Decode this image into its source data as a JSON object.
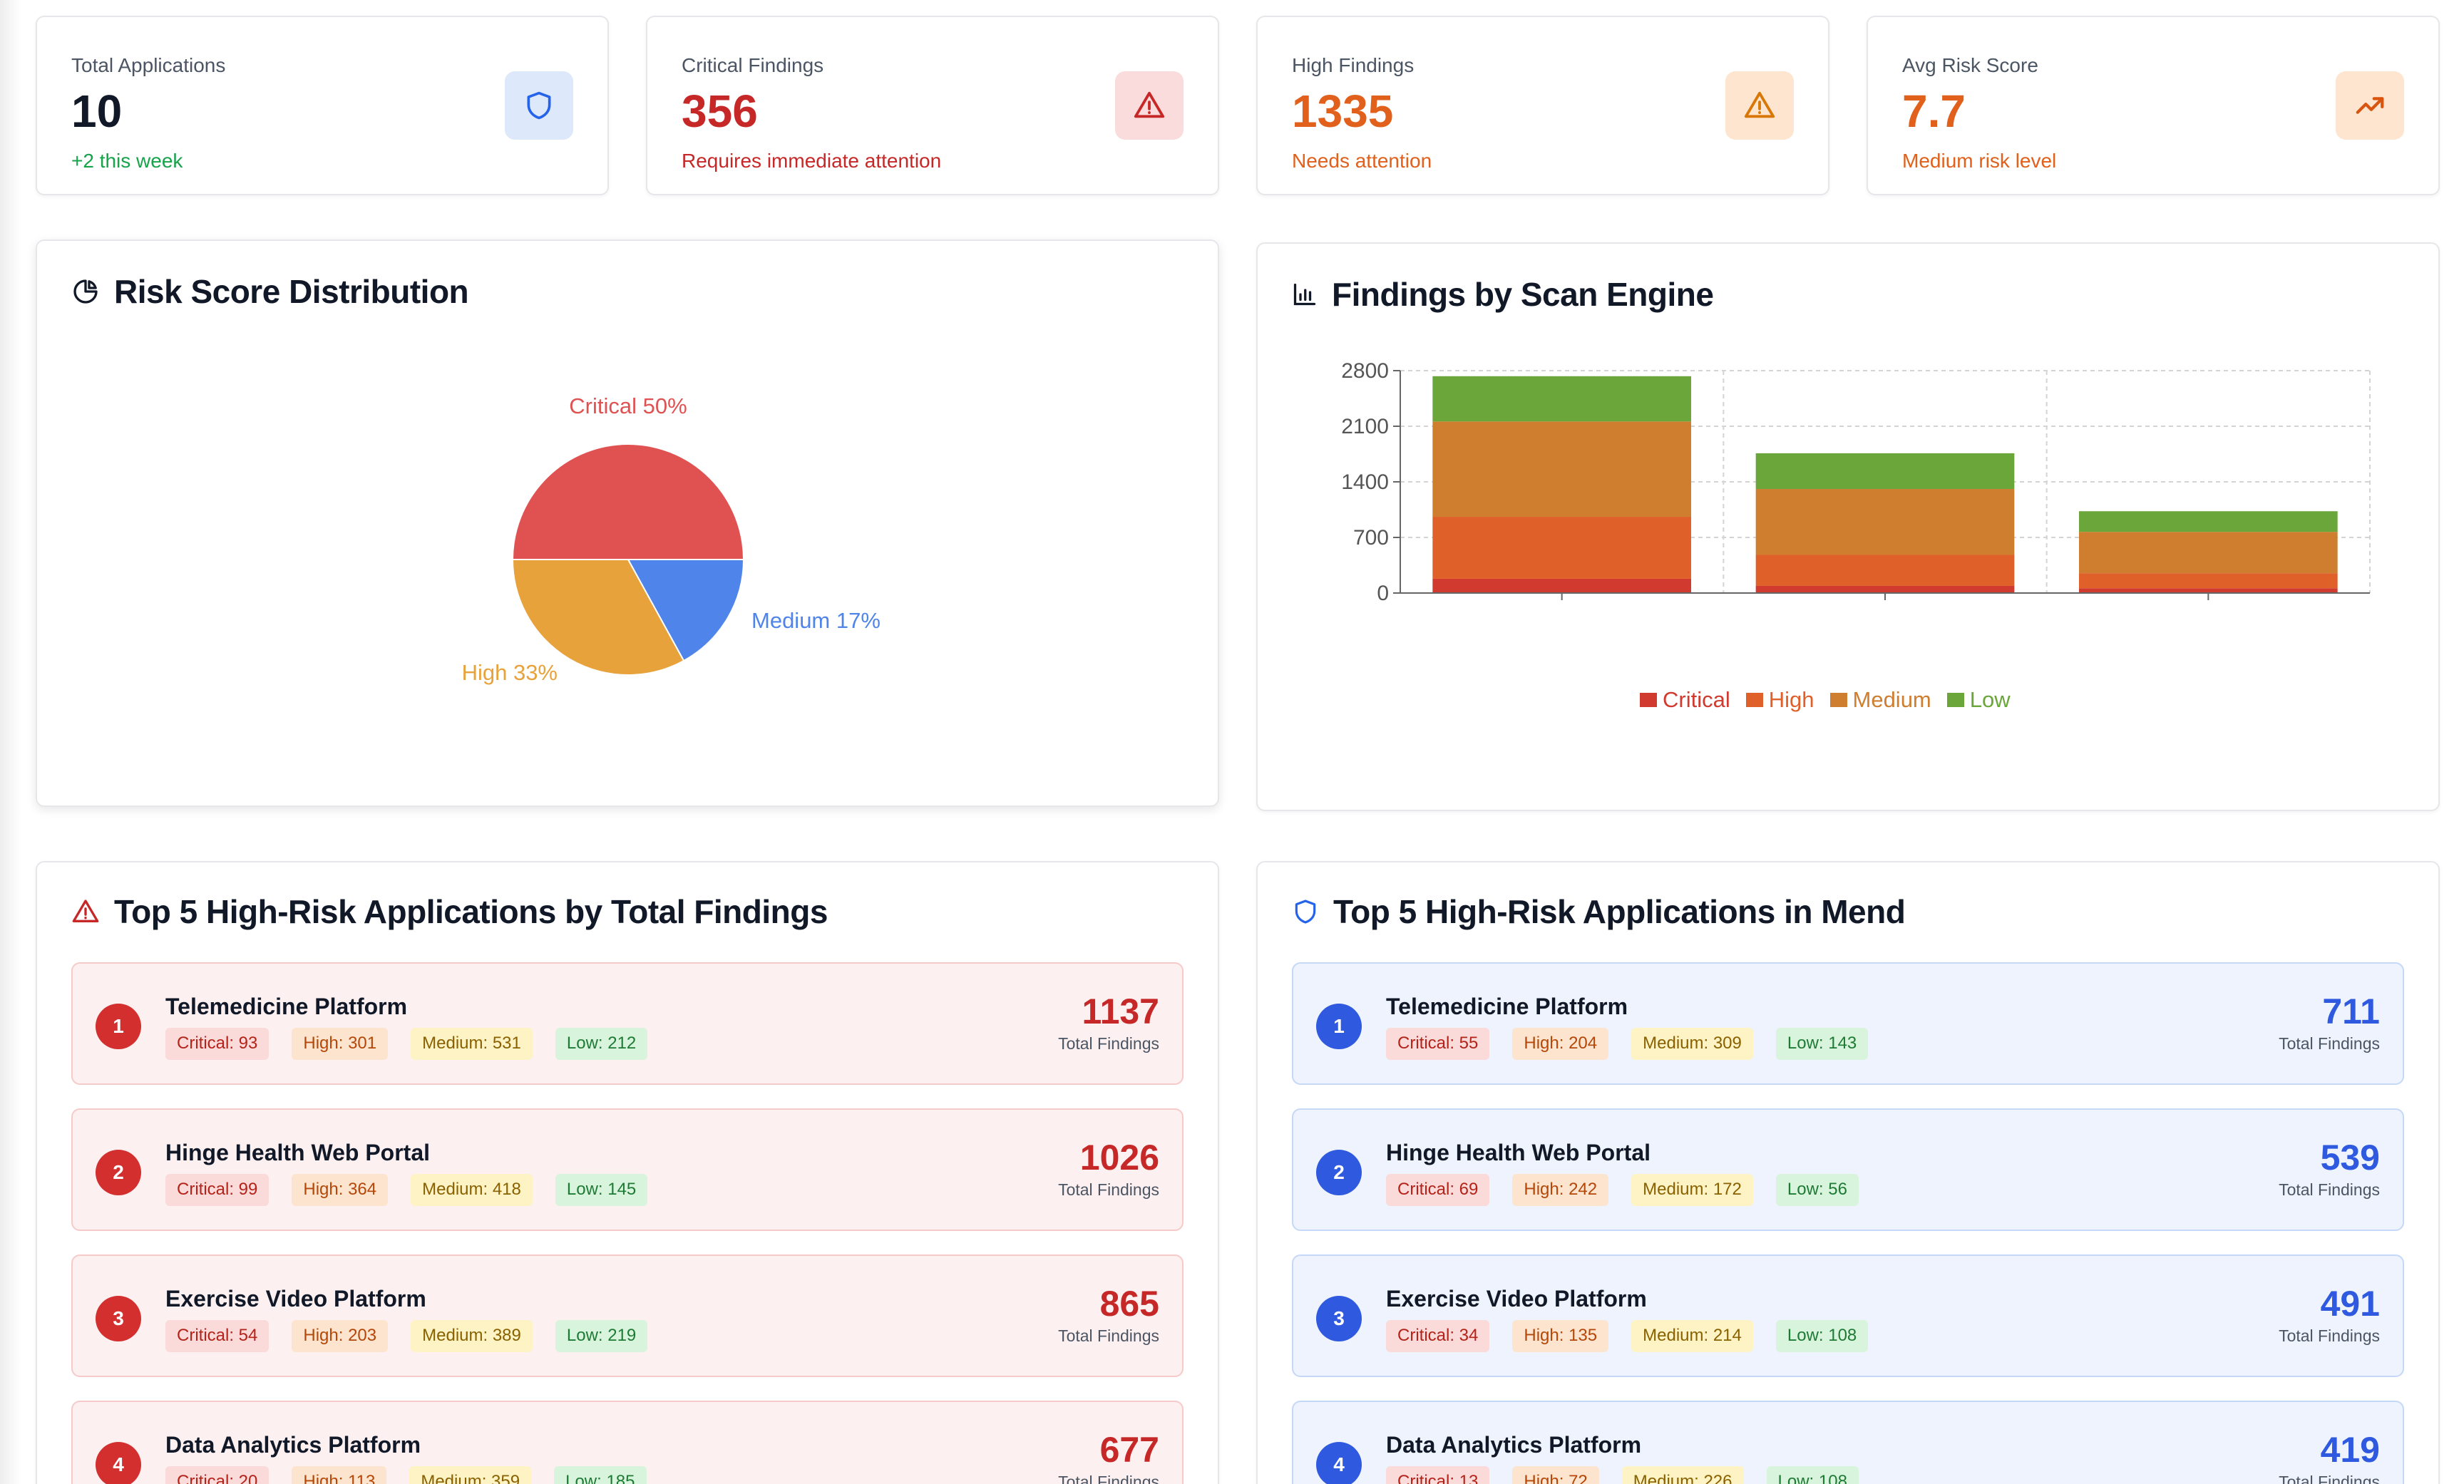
{
  "stats": [
    {
      "title": "Total Applications",
      "value": "10",
      "sub": "+2 this week",
      "value_color": "#111827",
      "sub_color": "#16a34a",
      "icon": "shield-icon",
      "icon_bg": "#dde8fb",
      "icon_color": "#2563eb"
    },
    {
      "title": "Critical Findings",
      "value": "356",
      "sub": "Requires immediate attention",
      "value_color": "#c62828",
      "sub_color": "#c62828",
      "icon": "alert-triangle-icon",
      "icon_bg": "#fbdcdc",
      "icon_color": "#c62828"
    },
    {
      "title": "High Findings",
      "value": "1335",
      "sub": "Needs attention",
      "value_color": "#e0601c",
      "sub_color": "#e0601c",
      "icon": "alert-triangle-icon",
      "icon_bg": "#fde5cf",
      "icon_color": "#d97706"
    },
    {
      "title": "Avg Risk Score",
      "value": "7.7",
      "sub": "Medium risk level",
      "value_color": "#e0601c",
      "sub_color": "#e0601c",
      "icon": "trending-up-icon",
      "icon_bg": "#fde5cf",
      "icon_color": "#d9550f"
    }
  ],
  "risk_distribution": {
    "title": "Risk Score Distribution",
    "icon": "pie-chart-icon",
    "labels": {
      "critical": "Critical 50%",
      "high": "High 33%",
      "medium": "Medium 17%"
    },
    "chart_data": {
      "type": "pie",
      "slices": [
        {
          "name": "Critical",
          "value": 50,
          "color": "#e05252"
        },
        {
          "name": "Medium",
          "value": 17,
          "color": "#4f84ea"
        },
        {
          "name": "High",
          "value": 33,
          "color": "#e8a23c"
        }
      ]
    }
  },
  "findings_by_engine": {
    "title": "Findings by Scan Engine",
    "icon": "bar-chart-icon",
    "chart_data": {
      "type": "bar",
      "stacked": true,
      "categories": [
        "",
        "",
        ""
      ],
      "yticks": [
        "0",
        "700",
        "1400",
        "2100",
        "2800"
      ],
      "ylim": [
        0,
        2800
      ],
      "grid": true,
      "legend_position": "bottom",
      "series": [
        {
          "name": "Critical",
          "color": "#d03a2f",
          "values": [
            180,
            90,
            60
          ]
        },
        {
          "name": "High",
          "color": "#e0602a",
          "values": [
            780,
            390,
            190
          ]
        },
        {
          "name": "Medium",
          "color": "#cf7e30",
          "values": [
            1200,
            830,
            520
          ]
        },
        {
          "name": "Low",
          "color": "#6aa63a",
          "values": [
            570,
            450,
            260
          ]
        }
      ]
    }
  },
  "top_total": {
    "title": "Top 5 High-Risk Applications by Total Findings",
    "icon": "alert-triangle-icon",
    "total_label": "Total Findings",
    "apps": [
      {
        "rank": "1",
        "name": "Telemedicine Platform",
        "critical": "Critical: 93",
        "high": "High: 301",
        "medium": "Medium: 531",
        "low": "Low: 212",
        "total": "1137"
      },
      {
        "rank": "2",
        "name": "Hinge Health Web Portal",
        "critical": "Critical: 99",
        "high": "High: 364",
        "medium": "Medium: 418",
        "low": "Low: 145",
        "total": "1026"
      },
      {
        "rank": "3",
        "name": "Exercise Video Platform",
        "critical": "Critical: 54",
        "high": "High: 203",
        "medium": "Medium: 389",
        "low": "Low: 219",
        "total": "865"
      },
      {
        "rank": "4",
        "name": "Data Analytics Platform",
        "critical": "Critical: 20",
        "high": "High: 113",
        "medium": "Medium: 359",
        "low": "Low: 185",
        "total": "677"
      }
    ]
  },
  "top_mend": {
    "title": "Top 5 High-Risk Applications in Mend",
    "icon": "shield-icon",
    "total_label": "Total Findings",
    "apps": [
      {
        "rank": "1",
        "name": "Telemedicine Platform",
        "critical": "Critical: 55",
        "high": "High: 204",
        "medium": "Medium: 309",
        "low": "Low: 143",
        "total": "711"
      },
      {
        "rank": "2",
        "name": "Hinge Health Web Portal",
        "critical": "Critical: 69",
        "high": "High: 242",
        "medium": "Medium: 172",
        "low": "Low: 56",
        "total": "539"
      },
      {
        "rank": "3",
        "name": "Exercise Video Platform",
        "critical": "Critical: 34",
        "high": "High: 135",
        "medium": "Medium: 214",
        "low": "Low: 108",
        "total": "491"
      },
      {
        "rank": "4",
        "name": "Data Analytics Platform",
        "critical": "Critical: 13",
        "high": "High: 72",
        "medium": "Medium: 226",
        "low": "Low: 108",
        "total": "419"
      }
    ]
  }
}
